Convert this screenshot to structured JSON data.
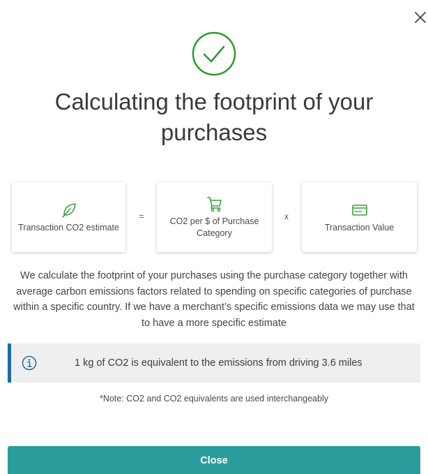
{
  "dialog": {
    "title": "Calculating the footprint of your purchases",
    "close_icon": "close-icon",
    "success_icon": "check-circle-icon",
    "accent_color": "#2b9c9c",
    "icon_green": "#3aa43a"
  },
  "formula": {
    "cards": [
      {
        "icon": "leaf-icon",
        "label": "Transaction CO2 estimate"
      },
      {
        "icon": "cart-icon",
        "label": "CO2 per $ of Purchase Category"
      },
      {
        "icon": "credit-card-icon",
        "label": "Transaction Value"
      }
    ],
    "equals": "=",
    "times": "x"
  },
  "description": "We calculate the footprint of your purchases using the purchase category together with average carbon emissions factors related to spending on specific categories of purchase within a specific country. If we have a merchant’s specific emissions data we may use that to have a more specific estimate",
  "info": {
    "icon": "info-icon",
    "text": "1 kg of CO2 is equivalent to the emissions from driving 3.6 miles",
    "border_color": "#1b6ca8"
  },
  "note": "*Note: CO2 and CO2 equivalents are used interchangeably",
  "actions": {
    "close_label": "Close"
  }
}
